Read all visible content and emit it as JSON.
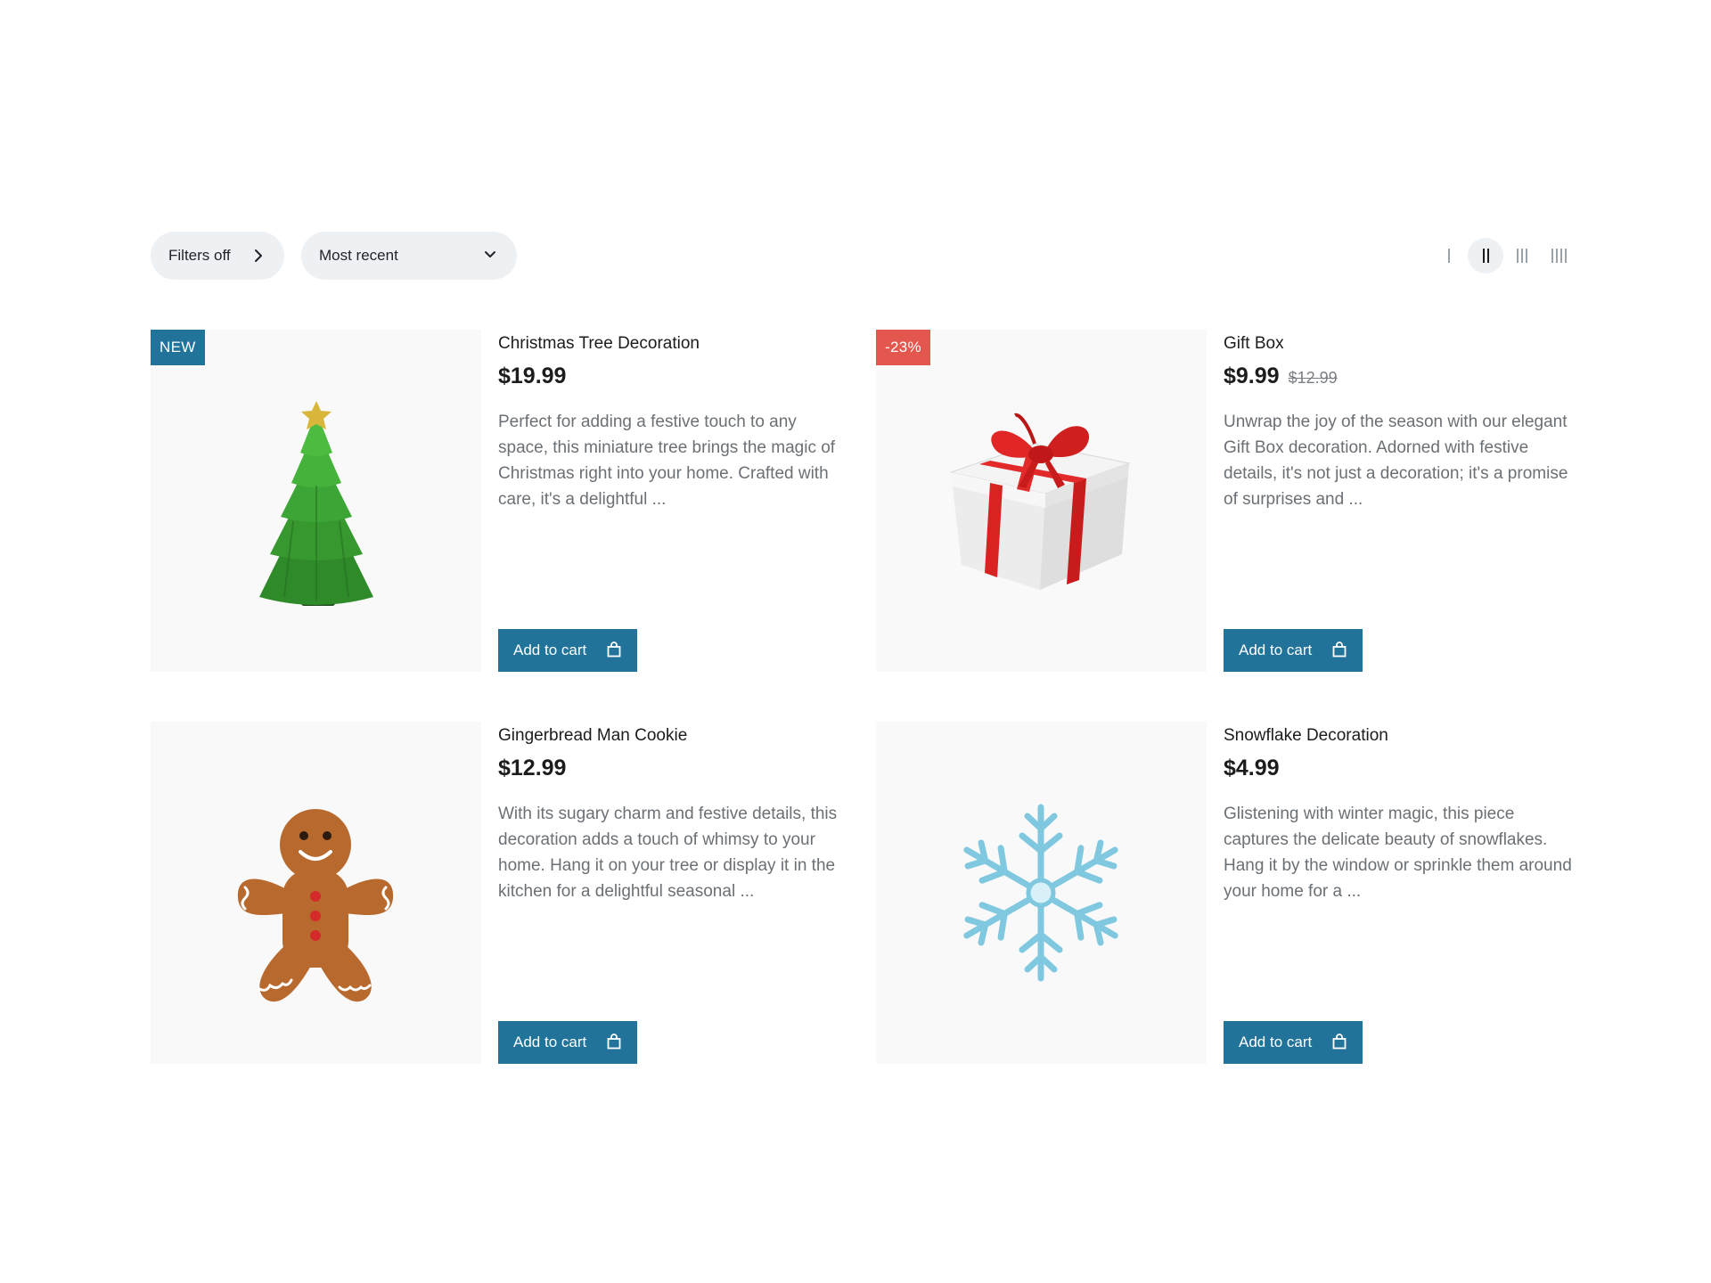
{
  "toolbar": {
    "filters_label": "Filters off",
    "sort_label": "Most recent",
    "view_options": [
      "1 column",
      "2 columns",
      "3 columns",
      "4 columns"
    ],
    "active_view": "2 columns"
  },
  "products": [
    {
      "title": "Christmas Tree Decoration",
      "price": "$19.99",
      "old_price": "",
      "badge": "NEW",
      "description": "Perfect for adding a festive touch to any space, this miniature tree brings the magic of Christmas right into your home. Crafted with care, it's a delightful ...",
      "cart_label": "Add to cart",
      "image_icon": "christmas-tree-icon"
    },
    {
      "title": "Gift Box",
      "price": "$9.99",
      "old_price": "$12.99",
      "badge": "-23%",
      "description": "Unwrap the joy of the season with our elegant Gift Box decoration. Adorned with festive details, it's not just a decoration; it's a promise of surprises and ...",
      "cart_label": "Add to cart",
      "image_icon": "gift-box-icon"
    },
    {
      "title": "Gingerbread Man Cookie",
      "price": "$12.99",
      "old_price": "",
      "badge": "",
      "description": "With its sugary charm and festive details, this decoration adds a touch of whimsy to your home. Hang it on your tree or display it in the kitchen for a delightful seasonal ...",
      "cart_label": "Add to cart",
      "image_icon": "gingerbread-man-icon"
    },
    {
      "title": "Snowflake Decoration",
      "price": "$4.99",
      "old_price": "",
      "badge": "",
      "description": "Glistening with winter magic, this piece captures the delicate beauty of snowflakes. Hang it by the window or sprinkle them around your home for a ...",
      "cart_label": "Add to cart",
      "image_icon": "snowflake-icon"
    }
  ],
  "colors": {
    "accent": "#22739a",
    "sale_badge": "#e4574f",
    "pill_bg": "#eef1f4",
    "image_bg": "#f9f9f9"
  }
}
